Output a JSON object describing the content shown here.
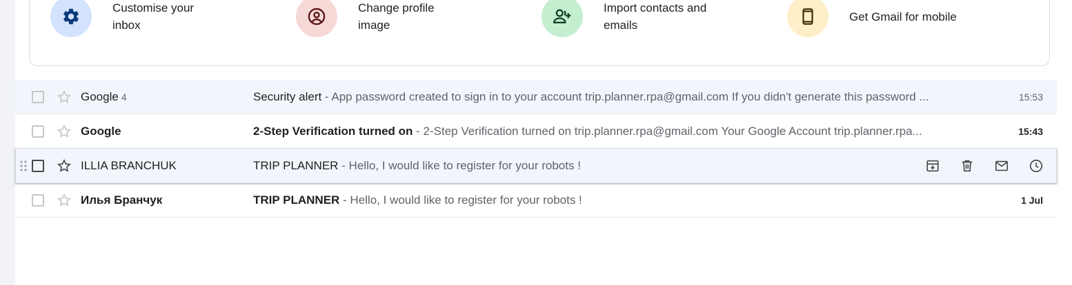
{
  "setup": {
    "items": [
      {
        "label": "Customise your inbox",
        "icon": "gear-icon",
        "bg": "#d3e3fd"
      },
      {
        "label": "Change profile image",
        "icon": "account-circle-icon",
        "bg": "#f6d9d7"
      },
      {
        "label": "Import contacts and emails",
        "icon": "person-add-icon",
        "bg": "#c4eed0"
      },
      {
        "label": "Get Gmail for mobile",
        "icon": "smartphone-icon",
        "bg": "#ffefc9"
      }
    ]
  },
  "emails": [
    {
      "sender": "Google",
      "count": "4",
      "subject": "Security alert",
      "snippet": " - App password created to sign in to your account trip.planner.rpa@gmail.com If you didn't generate this password ...",
      "date": "15:53",
      "unread": false
    },
    {
      "sender": "Google",
      "count": "",
      "subject": "2-Step Verification turned on",
      "snippet": " - 2-Step Verification turned on trip.planner.rpa@gmail.com Your Google Account trip.planner.rpa...",
      "date": "15:43",
      "unread": true
    },
    {
      "sender": "ILLIA BRANCHUK",
      "count": "",
      "subject": "TRIP PLANNER",
      "snippet": " - Hello, I would like to register for your robots !",
      "date": "",
      "unread": false
    },
    {
      "sender": "Илья Бранчук",
      "count": "",
      "subject": "TRIP PLANNER",
      "snippet": " - Hello, I would like to register for your robots !",
      "date": "1 Jul",
      "unread": true
    }
  ],
  "hover_actions": [
    "archive-icon",
    "delete-icon",
    "mark-unread-icon",
    "snooze-icon"
  ]
}
